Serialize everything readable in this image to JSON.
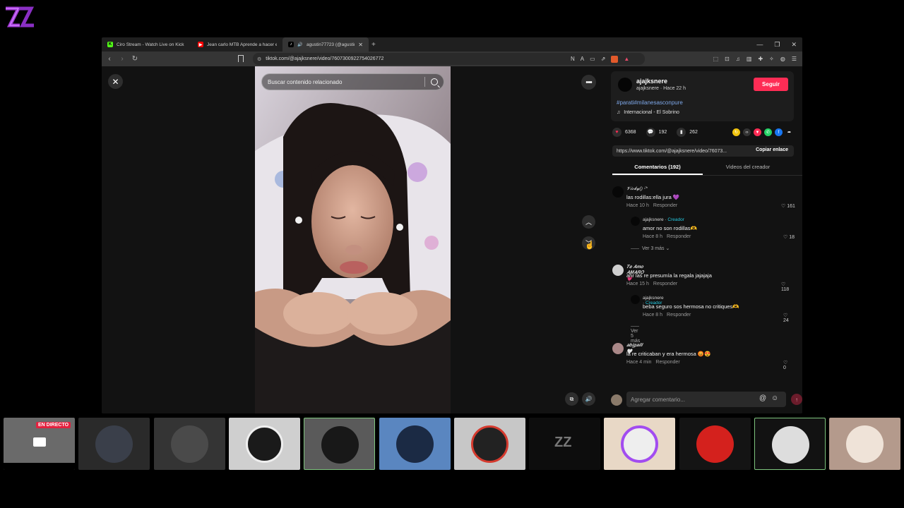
{
  "browser": {
    "tabs": [
      {
        "title": "Ciro Stream - Watch Live on Kick",
        "favicon": "kick-icon",
        "color": "#53fc18"
      },
      {
        "title": "Jean carlo MTB Aprende a hacer el r",
        "favicon": "youtube-icon",
        "color": "#ff0000"
      },
      {
        "title": "agustin77723 (@agustin777...",
        "favicon": "tiktok-icon",
        "color": "#000000"
      }
    ],
    "address": "tiktok.com/@ajajksnere/video/7607300922754026772"
  },
  "video": {
    "search_placeholder": "Buscar contenido relacionado"
  },
  "author": {
    "name": "ajajksnere",
    "subtitle": "ajajksnere · Hace 22 h",
    "follow_label": "Seguir",
    "hashtags": "#parati#milanesasconpure",
    "music": "Internacional - El Sobrino"
  },
  "stats": {
    "likes": "6368",
    "comments": "192",
    "saves": "262"
  },
  "share": {
    "link": "https://www.tiktok.com/@ajajksnere/video/76073...",
    "copy_label": "Copiar enlace"
  },
  "panel_tabs": {
    "comments": "Comentarios (192)",
    "creator_videos": "Videos del creador"
  },
  "comments": [
    {
      "user": "𝓥𝓲𝓬𝓴𝔂() ᵕ̈*",
      "text": "las rodillas:ella jura 💜",
      "time": "Hace 10 h",
      "reply": "Responder",
      "likes": "161",
      "creator_reply": {
        "user": "ajajksnere",
        "badge": "Creador",
        "text": "amor no son rodillas🫶",
        "time": "Hace 8 h",
        "reply": "Responder",
        "likes": "18"
      },
      "more": "Ver 3 más"
    },
    {
      "user": "𝑻𝒆 𝑨𝒎𝒐 𝑨𝑴𝑨𝑹𝑶 💗",
      "text": "ahr las re presumía la regala jajajaja",
      "time": "Hace 15 h",
      "reply": "Responder",
      "likes": "118",
      "creator_reply": {
        "user": "ajajksnere",
        "badge": "Creador",
        "text": "beba seguro sos hermosa no critiques🫶",
        "time": "Hace 8 h",
        "reply": "Responder",
        "likes": "24"
      },
      "more": "Ver 5 más"
    },
    {
      "user": "𝒂𝒃𝒊𝒈𝒂𝒊𝒍𝒍 🤍",
      "text": "la re criticaban y era hermosa 😡😍",
      "time": "Hace 4 min",
      "reply": "Responder",
      "likes": "0"
    }
  ],
  "comment_input": {
    "placeholder": "Agregar comentario..."
  },
  "stream": {
    "live_badge": "EN DIRECTO"
  }
}
